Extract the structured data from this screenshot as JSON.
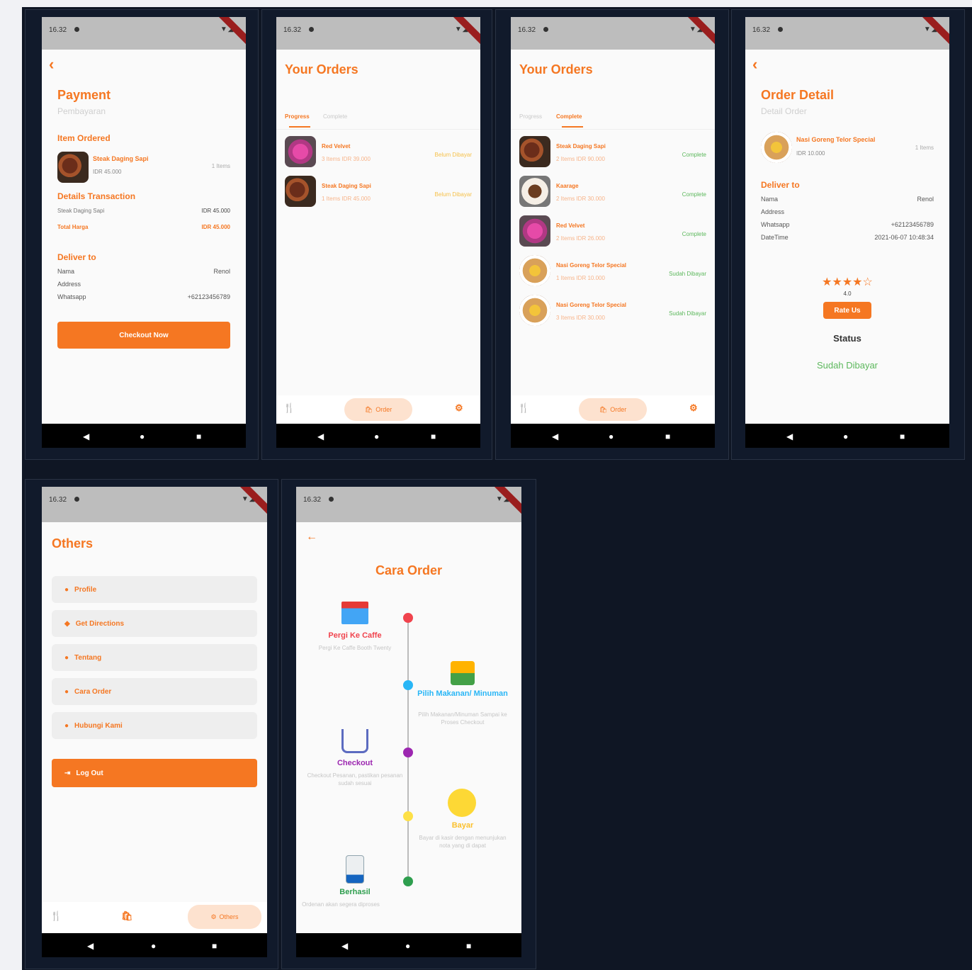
{
  "status_bar": {
    "time": "16.32",
    "signal": "▼◢▮"
  },
  "screens": {
    "payment": {
      "title": "Payment",
      "subtitle": "Pembayaran",
      "item_ordered_label": "Item Ordered",
      "item": {
        "name": "Steak Daging Sapi",
        "price": "IDR 45.000",
        "qty": "1 Items"
      },
      "details_label": "Details Transaction",
      "detail_row": {
        "name": "Steak Daging Sapi",
        "value": "IDR 45.000"
      },
      "total_label": "Total Harga",
      "total_value": "IDR 45.000",
      "deliver_label": "Deliver to",
      "deliver_rows": [
        {
          "label": "Nama",
          "value": "Renol"
        },
        {
          "label": "Address",
          "value": ""
        },
        {
          "label": "Whatsapp",
          "value": "+62123456789"
        }
      ],
      "checkout_label": "Checkout Now"
    },
    "orders_progress": {
      "title": "Your Orders",
      "tabs": [
        "Progress",
        "Complete"
      ],
      "items": [
        {
          "name": "Red Velvet",
          "meta": "3 Items IDR 39.000",
          "status": "Belum Dibayar"
        },
        {
          "name": "Steak Daging Sapi",
          "meta": "1 Items IDR 45.000",
          "status": "Belum Dibayar"
        }
      ],
      "nav_order_label": "Order"
    },
    "orders_complete": {
      "title": "Your Orders",
      "tabs": [
        "Progress",
        "Complete"
      ],
      "items": [
        {
          "name": "Steak Daging Sapi",
          "meta": "2 Items IDR 90.000",
          "status": "Complete"
        },
        {
          "name": "Kaarage",
          "meta": "2 Items IDR 30.000",
          "status": "Complete"
        },
        {
          "name": "Red Velvet",
          "meta": "2 Items IDR 26.000",
          "status": "Complete"
        },
        {
          "name": "Nasi Goreng Telor Special",
          "meta": "1 Items IDR 10.000",
          "status": "Sudah Dibayar"
        },
        {
          "name": "Nasi Goreng Telor Special",
          "meta": "3 Items IDR 30.000",
          "status": "Sudah Dibayar"
        }
      ],
      "nav_order_label": "Order"
    },
    "order_detail": {
      "title": "Order Detail",
      "subtitle": "Detail Order",
      "item": {
        "name": "Nasi Goreng Telor Special",
        "price": "IDR 10.000",
        "qty": "1 Items"
      },
      "deliver_label": "Deliver to",
      "rows": [
        {
          "label": "Nama",
          "value": "Renol"
        },
        {
          "label": "Address",
          "value": ""
        },
        {
          "label": "Whatsapp",
          "value": "+62123456789"
        },
        {
          "label": "DateTime",
          "value": "2021-06-07 10:48:34"
        }
      ],
      "rating_stars": "★★★★☆",
      "rating_value": "4.0",
      "rate_label": "Rate Us",
      "status_label": "Status",
      "status_value": "Sudah Dibayar"
    },
    "others": {
      "title": "Others",
      "menu": [
        "Profile",
        "Get Directions",
        "Tentang",
        "Cara Order",
        "Hubungi Kami"
      ],
      "logout_label": "Log Out",
      "nav_others_label": "Others"
    },
    "cara_order": {
      "title": "Cara Order",
      "steps": [
        {
          "title": "Pergi Ke Caffe",
          "desc": "Pergi Ke Caffe Booth Twenty"
        },
        {
          "title": "Pilih Makanan/ Minuman",
          "desc": "Pilih Makanan/Minuman Sampai ke Proses Checkout"
        },
        {
          "title": "Checkout",
          "desc": "Checkout Pesanan, pastikan pesanan sudah sesuai"
        },
        {
          "title": "Bayar",
          "desc": "Bayar di kasir dengan menunjukan nota yang di dapat"
        },
        {
          "title": "Berhasil",
          "desc": "Ordenan akan segera diproses"
        }
      ]
    }
  },
  "colors": {
    "accent": "#f57722",
    "success": "#5cb85c",
    "board": "#0f1624"
  },
  "icons": {
    "back": "‹",
    "arrow_back": "←",
    "restaurant": "🍴",
    "order": "🛍",
    "settings": "⚙",
    "nav_back": "◀",
    "nav_home": "●",
    "nav_recent": "■"
  }
}
